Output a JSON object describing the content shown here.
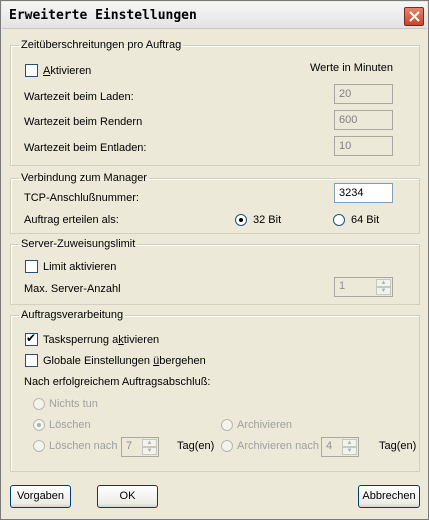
{
  "window": {
    "title": "Erweiterte Einstellungen"
  },
  "timeouts": {
    "legend": "Zeitüberschreitungen pro Auftrag",
    "activate_pre": "",
    "activate_u": "A",
    "activate_post": "ktivieren",
    "activate_checked": false,
    "units_label": "Werte in Minuten",
    "load_label": "Wartezeit beim Laden:",
    "load_value": "20",
    "render_label": "Wartezeit beim Rendern",
    "render_value": "600",
    "unload_label": "Wartezeit beim Entladen:",
    "unload_value": "10"
  },
  "manager": {
    "legend": "Verbindung zum Manager",
    "port_label": "TCP-Anschlußnummer:",
    "port_value": "3234",
    "assign_label": "Auftrag erteilen als:",
    "bit32_label": "32 Bit",
    "bit64_label": "64 Bit",
    "selected": "32 Bit"
  },
  "server_limit": {
    "legend": "Server-Zuweisungslimit",
    "limit_label": "Limit aktivieren",
    "limit_checked": false,
    "max_label": "Max. Server-Anzahl",
    "max_value": "1"
  },
  "job_processing": {
    "legend": "Auftragsverarbeitung",
    "lock_pre": "Tasksperrung a",
    "lock_u": "k",
    "lock_post": "tivieren",
    "lock_checked": true,
    "global_pre": "Globale Einstellungen ",
    "global_u": "ü",
    "global_post": "bergehen",
    "global_checked": false,
    "after_label": "Nach erfolgreichem Auftragsabschluß:",
    "nothing_label": "Nichts tun",
    "delete_label": "Löschen",
    "archive_label": "Archivieren",
    "delete_after_label": "Löschen nach",
    "delete_after_value": "7",
    "delete_after_unit": "Tag(en)",
    "archive_after_label": "Archivieren nach",
    "archive_after_value": "4",
    "archive_after_unit": "Tag(en)"
  },
  "buttons": {
    "defaults": "Vorgaben",
    "ok": "OK",
    "cancel": "Abbrechen"
  },
  "icons": {
    "close": "close-icon",
    "spin_up": "spin-up-arrow-icon",
    "spin_down": "spin-down-arrow-icon"
  },
  "colors": {
    "dialog_bg": "#ece9d8",
    "close_button": "#c8442a",
    "disabled_text": "#a0a0a0"
  }
}
